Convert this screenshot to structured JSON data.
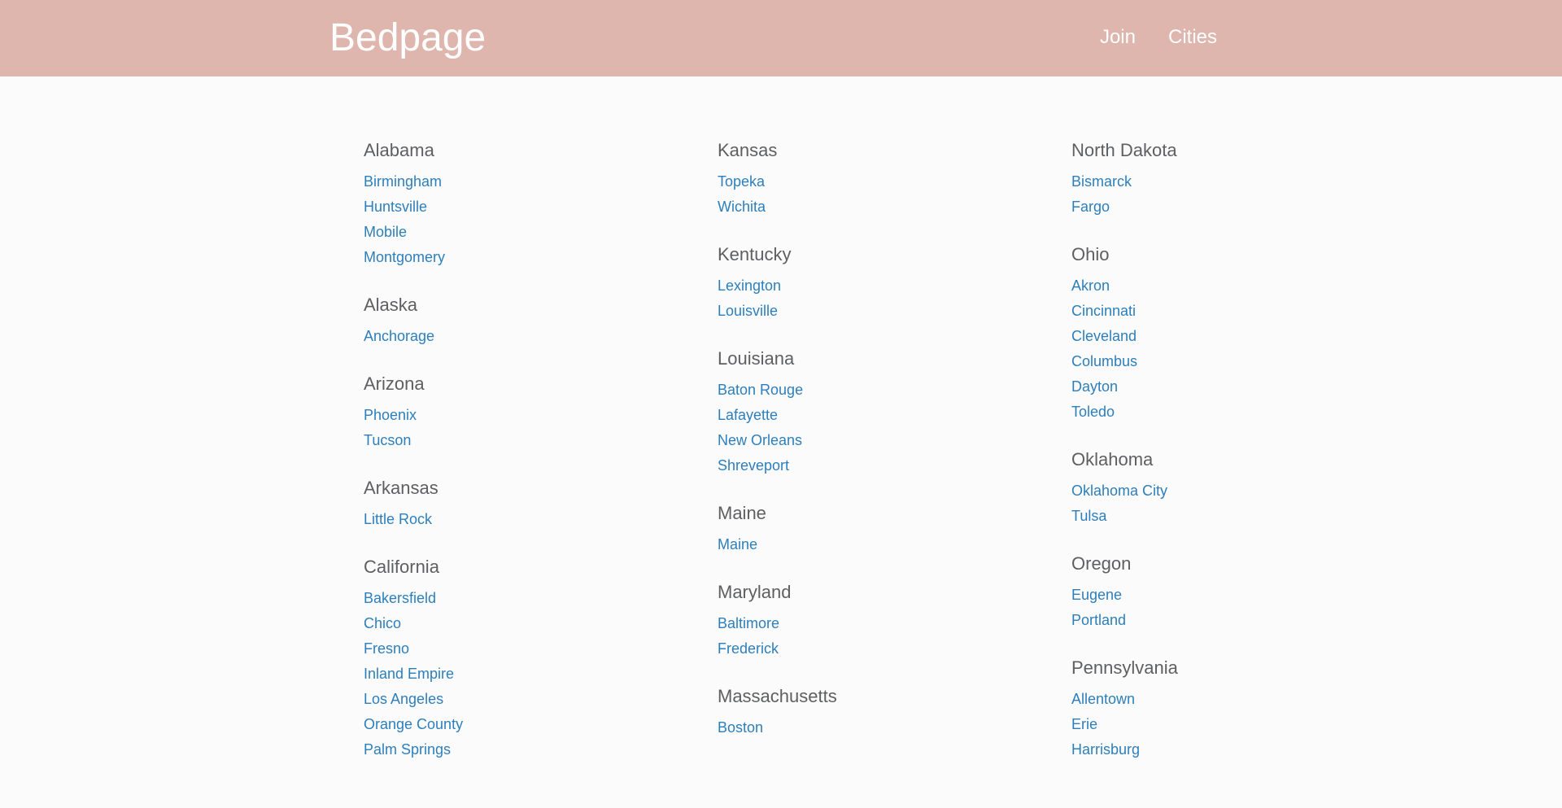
{
  "header": {
    "logo": "Bedpage",
    "nav": [
      "Join",
      "Cities"
    ]
  },
  "columns": [
    [
      {
        "state": "Alabama",
        "cities": [
          "Birmingham",
          "Huntsville",
          "Mobile",
          "Montgomery"
        ]
      },
      {
        "state": "Alaska",
        "cities": [
          "Anchorage"
        ]
      },
      {
        "state": "Arizona",
        "cities": [
          "Phoenix",
          "Tucson"
        ]
      },
      {
        "state": "Arkansas",
        "cities": [
          "Little Rock"
        ]
      },
      {
        "state": "California",
        "cities": [
          "Bakersfield",
          "Chico",
          "Fresno",
          "Inland Empire",
          "Los Angeles",
          "Orange County",
          "Palm Springs"
        ]
      }
    ],
    [
      {
        "state": "Kansas",
        "cities": [
          "Topeka",
          "Wichita"
        ]
      },
      {
        "state": "Kentucky",
        "cities": [
          "Lexington",
          "Louisville"
        ]
      },
      {
        "state": "Louisiana",
        "cities": [
          "Baton Rouge",
          "Lafayette",
          "New Orleans",
          "Shreveport"
        ]
      },
      {
        "state": "Maine",
        "cities": [
          "Maine"
        ]
      },
      {
        "state": "Maryland",
        "cities": [
          "Baltimore",
          "Frederick"
        ]
      },
      {
        "state": "Massachusetts",
        "cities": [
          "Boston"
        ]
      }
    ],
    [
      {
        "state": "North Dakota",
        "cities": [
          "Bismarck",
          "Fargo"
        ]
      },
      {
        "state": "Ohio",
        "cities": [
          "Akron",
          "Cincinnati",
          "Cleveland",
          "Columbus",
          "Dayton",
          "Toledo"
        ]
      },
      {
        "state": "Oklahoma",
        "cities": [
          "Oklahoma City",
          "Tulsa"
        ]
      },
      {
        "state": "Oregon",
        "cities": [
          "Eugene",
          "Portland"
        ]
      },
      {
        "state": "Pennsylvania",
        "cities": [
          "Allentown",
          "Erie",
          "Harrisburg"
        ]
      }
    ]
  ],
  "colors": {
    "header_bg": "#dfb6ad",
    "page_bg": "#fcfbfc",
    "state_text": "#5d5f60",
    "link": "#2c7fbb"
  }
}
